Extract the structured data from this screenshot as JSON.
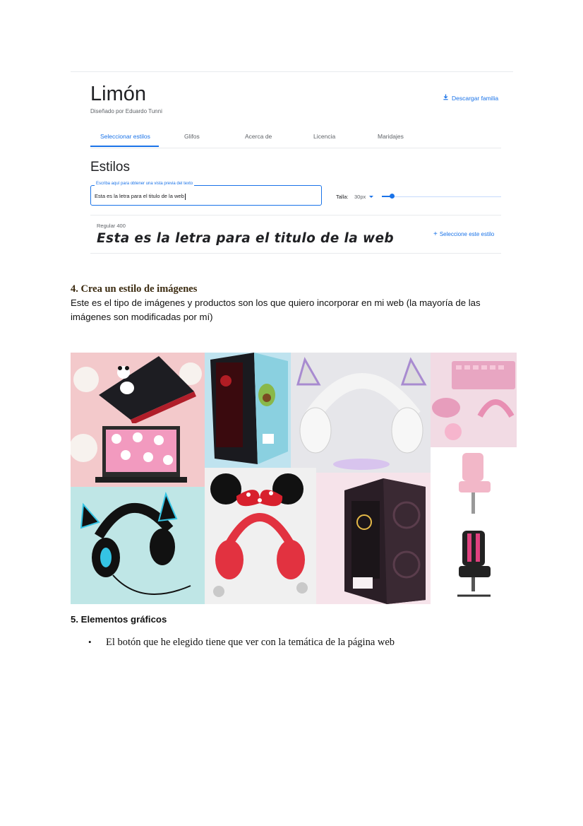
{
  "fonts_screenshot": {
    "family_title": "Limón",
    "designer": "Diseñado por Eduardo Tunni",
    "download_label": "Descargar familia",
    "tabs": [
      {
        "label": "Seleccionar estilos",
        "active": true
      },
      {
        "label": "Glifos",
        "active": false
      },
      {
        "label": "Acerca de",
        "active": false
      },
      {
        "label": "Licencia",
        "active": false
      },
      {
        "label": "Maridajes",
        "active": false
      }
    ],
    "section_title": "Estilos",
    "preview_input": {
      "label": "Escriba aquí para obtener una vista previa del texto",
      "value": "Esta es la letra para el titulo de la web"
    },
    "size_label": "Talla:",
    "size_value": "30px",
    "style_card": {
      "weight": "Regular 400",
      "sample": "Esta es la letra para el titulo de la web",
      "select_label": "Seleccione este estilo"
    },
    "accent_color": "#1a73e8"
  },
  "section4": {
    "heading": "4. Crea un estilo de imágenes",
    "paragraph": "Este es el tipo de imágenes y productos son los que quiero incorporar en mi web (la mayoría de las imágenes son modificadas por mí)"
  },
  "collage_items": [
    "laptop-panda",
    "pc-case-avocado",
    "cat-ear-headphones-white",
    "pink-keyboard-setup",
    "laptop-pattern",
    "gaming-chairs-pink",
    "cat-ear-headphones-blue",
    "minnie-headphones",
    "pc-case-glass"
  ],
  "section5": {
    "heading": "5. Elementos gráficos",
    "bullets": [
      "El botón que he elegido tiene que ver con la temática de la página web"
    ]
  }
}
